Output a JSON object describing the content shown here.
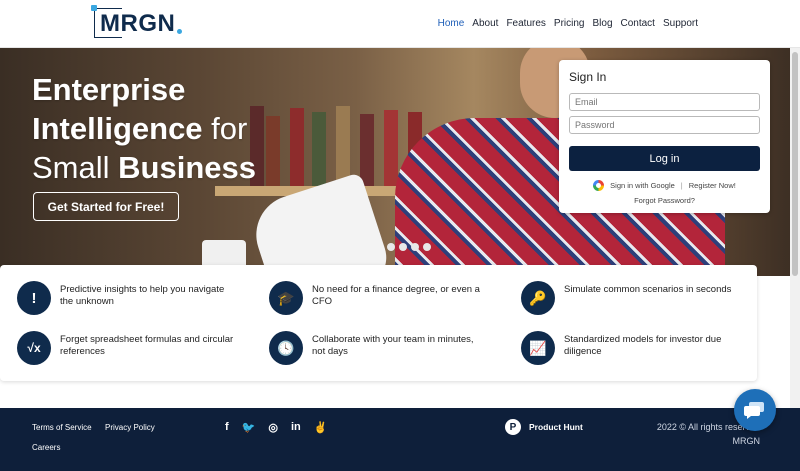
{
  "brand": {
    "logo_text": "MRGN"
  },
  "nav": {
    "items": [
      {
        "label": "Home",
        "active": true
      },
      {
        "label": "About"
      },
      {
        "label": "Features"
      },
      {
        "label": "Pricing"
      },
      {
        "label": "Blog"
      },
      {
        "label": "Contact"
      },
      {
        "label": "Support"
      }
    ]
  },
  "hero": {
    "line1": "Enterprise",
    "line2_bold": "Intelligence",
    "line2_light": " for",
    "line3_light": "Small ",
    "line3_bold": "Business",
    "cta_label": "Get Started for Free!"
  },
  "signin": {
    "title": "Sign In",
    "email_placeholder": "Email",
    "password_placeholder": "Password",
    "login_label": "Log in",
    "google_label": "Sign in with Google",
    "separator": "|",
    "register_label": "Register Now!",
    "forgot_label": "Forgot Password?"
  },
  "features": [
    {
      "icon": "!",
      "text": "Predictive insights to help you navigate the unknown"
    },
    {
      "icon": "🎓",
      "text": "No need for a finance degree, or even a CFO"
    },
    {
      "icon": "🔑",
      "text": "Simulate common scenarios in seconds"
    },
    {
      "icon": "√x",
      "text": "Forget spreadsheet formulas and circular references"
    },
    {
      "icon": "🕓",
      "text": "Collaborate with your team in minutes, not days"
    },
    {
      "icon": "📈",
      "text": "Standardized models for investor due diligence"
    }
  ],
  "footer": {
    "terms": "Terms of Service",
    "privacy": "Privacy Policy",
    "careers": "Careers",
    "social": {
      "facebook": "f",
      "twitter": "🐦",
      "instagram": "◎",
      "linkedin": "in",
      "angellist": "✌"
    },
    "product_hunt_icon": "P",
    "product_hunt": "Product Hunt",
    "copyright": "2022 © All rights reserved",
    "company": "MRGN"
  },
  "colors": {
    "navy": "#0f2b4c",
    "accent": "#3aa7e0",
    "nav_active": "#1f5fb8",
    "footer_bg": "#0e1f3a",
    "chat": "#1e6fb8"
  }
}
